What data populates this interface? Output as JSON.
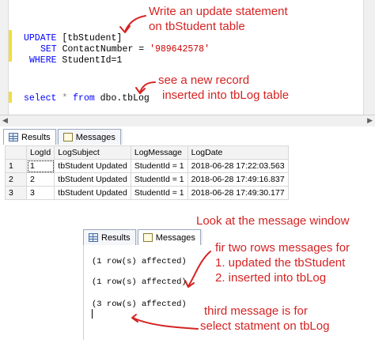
{
  "editor": {
    "lines": {
      "update_kw": "UPDATE",
      "update_table": "[tbStudent]",
      "set_kw": "SET",
      "set_col": "ContactNumber =",
      "set_val": "'989642578'",
      "where_kw": "WHERE",
      "where_cond": "StudentId=1",
      "select_kw": "select",
      "select_star": "*",
      "from_kw": "from",
      "from_table": "dbo.tbLog"
    }
  },
  "annotations": {
    "update_note_1": "Write an update statement",
    "update_note_2": "on tbStudent table",
    "select_note_1": "see a new record",
    "select_note_2": "inserted into tbLog table",
    "look_note": "Look at the message window",
    "two_rows_1": "fir two rows messages for",
    "two_rows_2": "1. updated the tbStudent",
    "two_rows_3": "2. inserted into tbLog",
    "third_1": "third message is for",
    "third_2": "select statment on tbLog"
  },
  "results_tabs": {
    "results": "Results",
    "messages": "Messages"
  },
  "grid": {
    "columns": [
      "LogId",
      "LogSubject",
      "LogMessage",
      "LogDate"
    ],
    "rows": [
      {
        "num": "1",
        "logid": "1",
        "subject": "tbStudent Updated",
        "message": "StudentId = 1",
        "date": "2018-06-28 17:22:03.563"
      },
      {
        "num": "2",
        "logid": "2",
        "subject": "tbStudent Updated",
        "message": "StudentId = 1",
        "date": "2018-06-28 17:49:16.837"
      },
      {
        "num": "3",
        "logid": "3",
        "subject": "tbStudent Updated",
        "message": "StudentId = 1",
        "date": "2018-06-28 17:49:30.177"
      }
    ]
  },
  "messages_tabs": {
    "results": "Results",
    "messages": "Messages"
  },
  "messages": {
    "m1": "(1 row(s) affected)",
    "m2": "(1 row(s) affected)",
    "m3": "(3 row(s) affected)"
  },
  "colors": {
    "annotation": "#d62323",
    "keyword": "#0000ff",
    "string": "#d00000"
  }
}
